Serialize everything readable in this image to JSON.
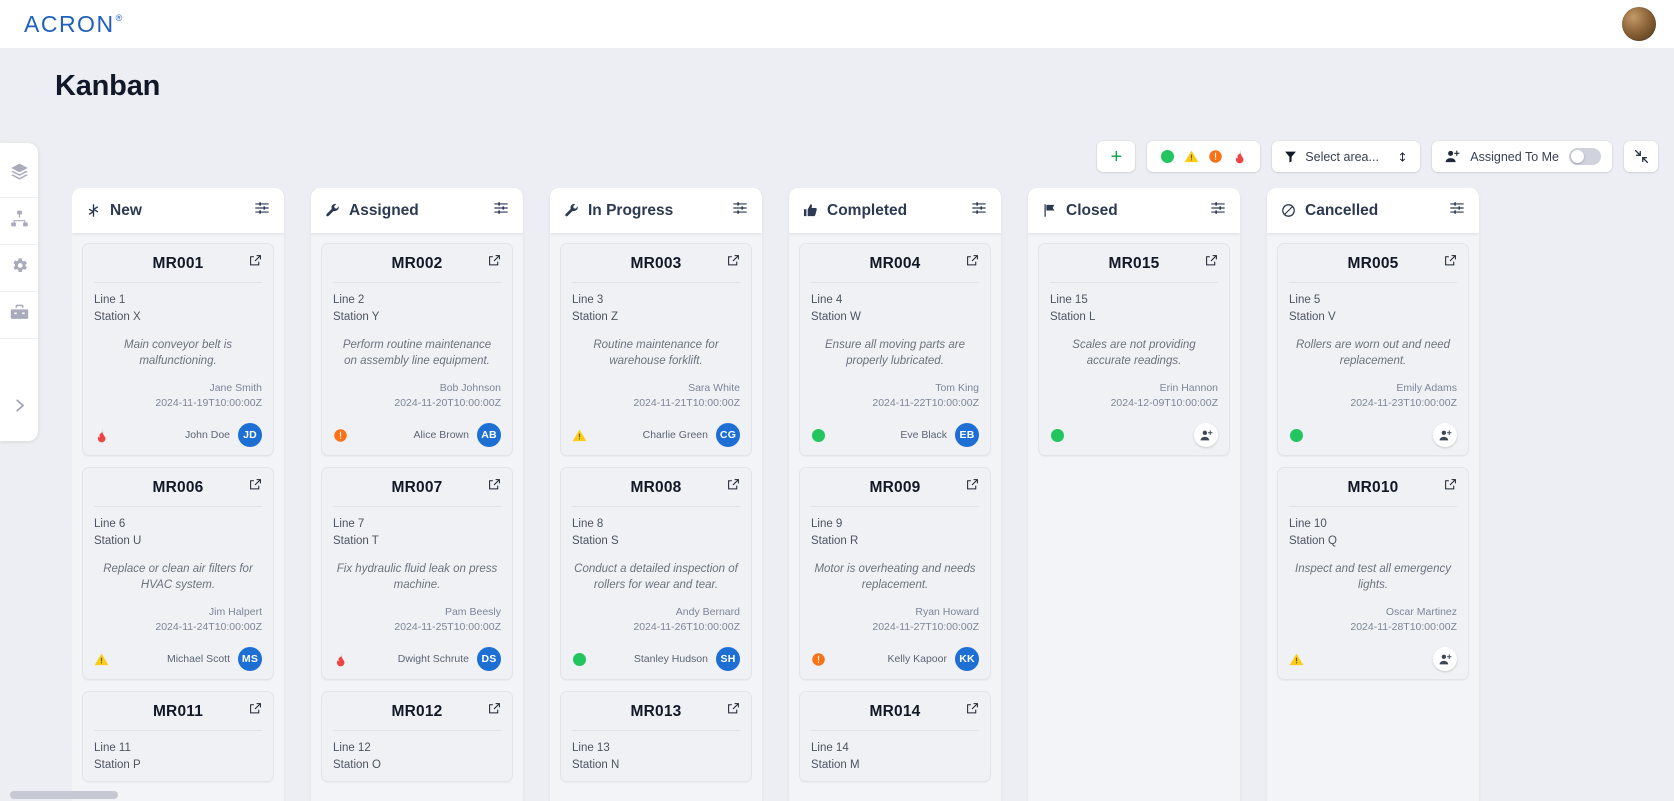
{
  "brand": {
    "name": "ACRON",
    "registered": "®"
  },
  "header": {
    "title": "Kanban"
  },
  "sidebar": {
    "items": [
      {
        "name": "layers-icon",
        "label": "Layers"
      },
      {
        "name": "sitemap-icon",
        "label": "Hierarchy"
      },
      {
        "name": "gear-icon",
        "label": "Settings"
      },
      {
        "name": "toolbox-icon",
        "label": "Maintenance"
      }
    ],
    "expand_label": "Expand"
  },
  "toolbar": {
    "add_label": "+",
    "priority_legend": [
      "low",
      "medium",
      "high",
      "critical"
    ],
    "select_area_label": "Select area...",
    "assigned_to_me_label": "Assigned To Me",
    "assigned_to_me_on": false,
    "collapse_label": "Collapse"
  },
  "colors": {
    "brand": "#1f5fbf",
    "low": "#22c55e",
    "medium": "#facc15",
    "high": "#f97316",
    "critical": "#ef4444",
    "avatar": "#1d6fd4",
    "page_bg": "#eceef3",
    "column_bg": "#f3f4f7",
    "card_bg": "#f0f1f4"
  },
  "board": {
    "columns": [
      {
        "title": "New",
        "icon": "asterisk-icon",
        "settings_icon": "sliders-icon",
        "cards": [
          {
            "id": "MR001",
            "line": "Line 1",
            "station": "Station X",
            "description": "Main conveyor belt is malfunctioning.",
            "reporter": "Jane Smith",
            "timestamp": "2024-11-19T10:00:00Z",
            "priority": "critical",
            "assignee": "John Doe",
            "initials": "JD"
          },
          {
            "id": "MR006",
            "line": "Line 6",
            "station": "Station U",
            "description": "Replace or clean air filters for HVAC system.",
            "reporter": "Jim Halpert",
            "timestamp": "2024-11-24T10:00:00Z",
            "priority": "medium",
            "assignee": "Michael Scott",
            "initials": "MS"
          },
          {
            "id": "MR011",
            "line": "Line 11",
            "station": "Station P",
            "description": "",
            "reporter": "",
            "timestamp": "",
            "priority": "",
            "assignee": "",
            "initials": ""
          }
        ]
      },
      {
        "title": "Assigned",
        "icon": "wrench-icon",
        "settings_icon": "sliders-icon",
        "cards": [
          {
            "id": "MR002",
            "line": "Line 2",
            "station": "Station Y",
            "description": "Perform routine maintenance on assembly line equipment.",
            "reporter": "Bob Johnson",
            "timestamp": "2024-11-20T10:00:00Z",
            "priority": "high",
            "assignee": "Alice Brown",
            "initials": "AB"
          },
          {
            "id": "MR007",
            "line": "Line 7",
            "station": "Station T",
            "description": "Fix hydraulic fluid leak on press machine.",
            "reporter": "Pam Beesly",
            "timestamp": "2024-11-25T10:00:00Z",
            "priority": "critical",
            "assignee": "Dwight Schrute",
            "initials": "DS"
          },
          {
            "id": "MR012",
            "line": "Line 12",
            "station": "Station O",
            "description": "",
            "reporter": "",
            "timestamp": "",
            "priority": "",
            "assignee": "",
            "initials": ""
          }
        ]
      },
      {
        "title": "In Progress",
        "icon": "wrench-icon",
        "settings_icon": "sliders-icon",
        "cards": [
          {
            "id": "MR003",
            "line": "Line 3",
            "station": "Station Z",
            "description": "Routine maintenance for warehouse forklift.",
            "reporter": "Sara White",
            "timestamp": "2024-11-21T10:00:00Z",
            "priority": "medium",
            "assignee": "Charlie Green",
            "initials": "CG"
          },
          {
            "id": "MR008",
            "line": "Line 8",
            "station": "Station S",
            "description": "Conduct a detailed inspection of rollers for wear and tear.",
            "reporter": "Andy Bernard",
            "timestamp": "2024-11-26T10:00:00Z",
            "priority": "low",
            "assignee": "Stanley Hudson",
            "initials": "SH"
          },
          {
            "id": "MR013",
            "line": "Line 13",
            "station": "Station N",
            "description": "",
            "reporter": "",
            "timestamp": "",
            "priority": "",
            "assignee": "",
            "initials": ""
          }
        ]
      },
      {
        "title": "Completed",
        "icon": "thumbs-up-icon",
        "settings_icon": "sliders-icon",
        "cards": [
          {
            "id": "MR004",
            "line": "Line 4",
            "station": "Station W",
            "description": "Ensure all moving parts are properly lubricated.",
            "reporter": "Tom King",
            "timestamp": "2024-11-22T10:00:00Z",
            "priority": "low",
            "assignee": "Eve Black",
            "initials": "EB"
          },
          {
            "id": "MR009",
            "line": "Line 9",
            "station": "Station R",
            "description": "Motor is overheating and needs replacement.",
            "reporter": "Ryan Howard",
            "timestamp": "2024-11-27T10:00:00Z",
            "priority": "high",
            "assignee": "Kelly Kapoor",
            "initials": "KK"
          },
          {
            "id": "MR014",
            "line": "Line 14",
            "station": "Station M",
            "description": "",
            "reporter": "",
            "timestamp": "",
            "priority": "",
            "assignee": "",
            "initials": ""
          }
        ]
      },
      {
        "title": "Closed",
        "icon": "flag-icon",
        "settings_icon": "sliders-icon",
        "cards": [
          {
            "id": "MR015",
            "line": "Line 15",
            "station": "Station L",
            "description": "Scales are not providing accurate readings.",
            "reporter": "Erin Hannon",
            "timestamp": "2024-12-09T10:00:00Z",
            "priority": "low",
            "assignee": "",
            "initials": ""
          }
        ]
      },
      {
        "title": "Cancelled",
        "icon": "ban-icon",
        "settings_icon": "sliders-icon",
        "cards": [
          {
            "id": "MR005",
            "line": "Line 5",
            "station": "Station V",
            "description": "Rollers are worn out and need replacement.",
            "reporter": "Emily Adams",
            "timestamp": "2024-11-23T10:00:00Z",
            "priority": "low",
            "assignee": "",
            "initials": ""
          },
          {
            "id": "MR010",
            "line": "Line 10",
            "station": "Station Q",
            "description": "Inspect and test all emergency lights.",
            "reporter": "Oscar Martinez",
            "timestamp": "2024-11-28T10:00:00Z",
            "priority": "medium",
            "assignee": "",
            "initials": ""
          }
        ]
      }
    ]
  }
}
